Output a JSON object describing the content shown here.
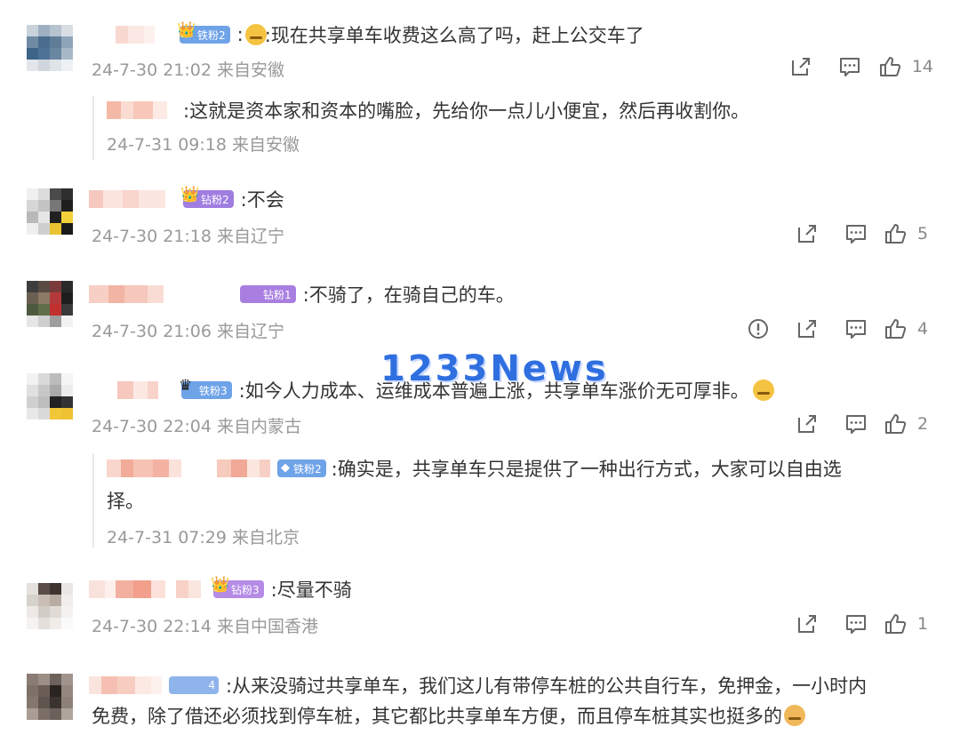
{
  "watermark": "1233News",
  "comments": [
    {
      "badge": "铁粉2",
      "text": ":现在共享单车收费这么高了吗，赶上公交车了",
      "meta": "24-7-30 21:02 来自安徽",
      "likes": "14",
      "reply": {
        "text": ":这就是资本家和资本的嘴脸，先给你一点儿小便宜，然后再收割你。",
        "meta": "24-7-31 09:18 来自安徽"
      }
    },
    {
      "badge": "钻粉2",
      "text": ":不会",
      "meta": "24-7-30 21:18 来自辽宁",
      "likes": "5"
    },
    {
      "badge": "钻粉1",
      "text": ":不骑了，在骑自己的车。",
      "meta": "24-7-30 21:06 来自辽宁",
      "likes": "4"
    },
    {
      "badge": "铁粉3",
      "text": ":如今人力成本、运维成本普遍上涨，共享单车涨价无可厚非。",
      "meta": "24-7-30 22:04 来自内蒙古",
      "likes": "2",
      "reply": {
        "badge": "铁粉2",
        "text": ":确实是，共享单车只是提供了一种出行方式，大家可以自由选",
        "text2": "择。",
        "meta": "24-7-31 07:29 来自北京"
      }
    },
    {
      "badge": "钻粉3",
      "text": ":尽量不骑",
      "meta": "24-7-30 22:14 来自中国香港",
      "likes": "1"
    },
    {
      "badge": "4",
      "text": ":从来没骑过共享单车，我们这儿有带停车桩的公共自行车，免押金，一小时内",
      "text2": "免费，除了借还必须找到停车桩，其它都比共享单车方便，而且停车桩其实也挺多的"
    }
  ],
  "icons": {
    "share": "share-icon",
    "comment": "comment-icon",
    "like": "like-icon",
    "report": "report-icon"
  },
  "colors": {
    "meta": "#999999",
    "text": "#333333",
    "tie_badge": "#6fa3e8",
    "zuan_badge": "#a07de0",
    "watermark": "#2f6fe0"
  }
}
